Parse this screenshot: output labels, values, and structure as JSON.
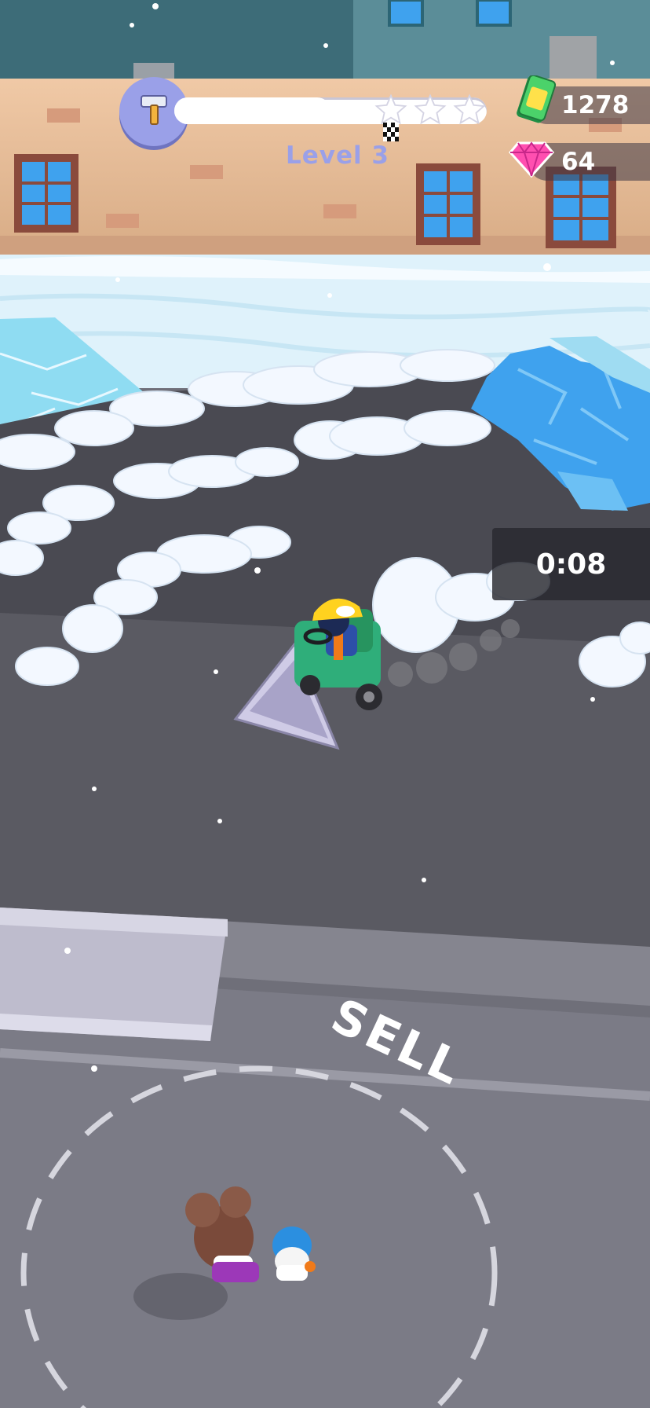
{
  "hud": {
    "level_label": "Level 3",
    "level_progress": 0.5,
    "stars_earned": 0,
    "stars_total": 3,
    "cash_amount": "1278",
    "gem_amount": "64",
    "timer": "0:08",
    "tool_icon": "hammer-icon"
  },
  "world": {
    "sell_zone_label": "SELL"
  },
  "colors": {
    "wall": "#e8bf9b",
    "window_frame": "#8a4a3c",
    "window_glass": "#3fa2ee",
    "snow": "#eef4fb",
    "ice": "#7fd3ee",
    "asphalt_dark": "#4a4a52",
    "asphalt_light": "#6f6f79",
    "plow_body": "#2fae7a",
    "helmet": "#ffd21f",
    "level_text": "#9aa0e8"
  }
}
